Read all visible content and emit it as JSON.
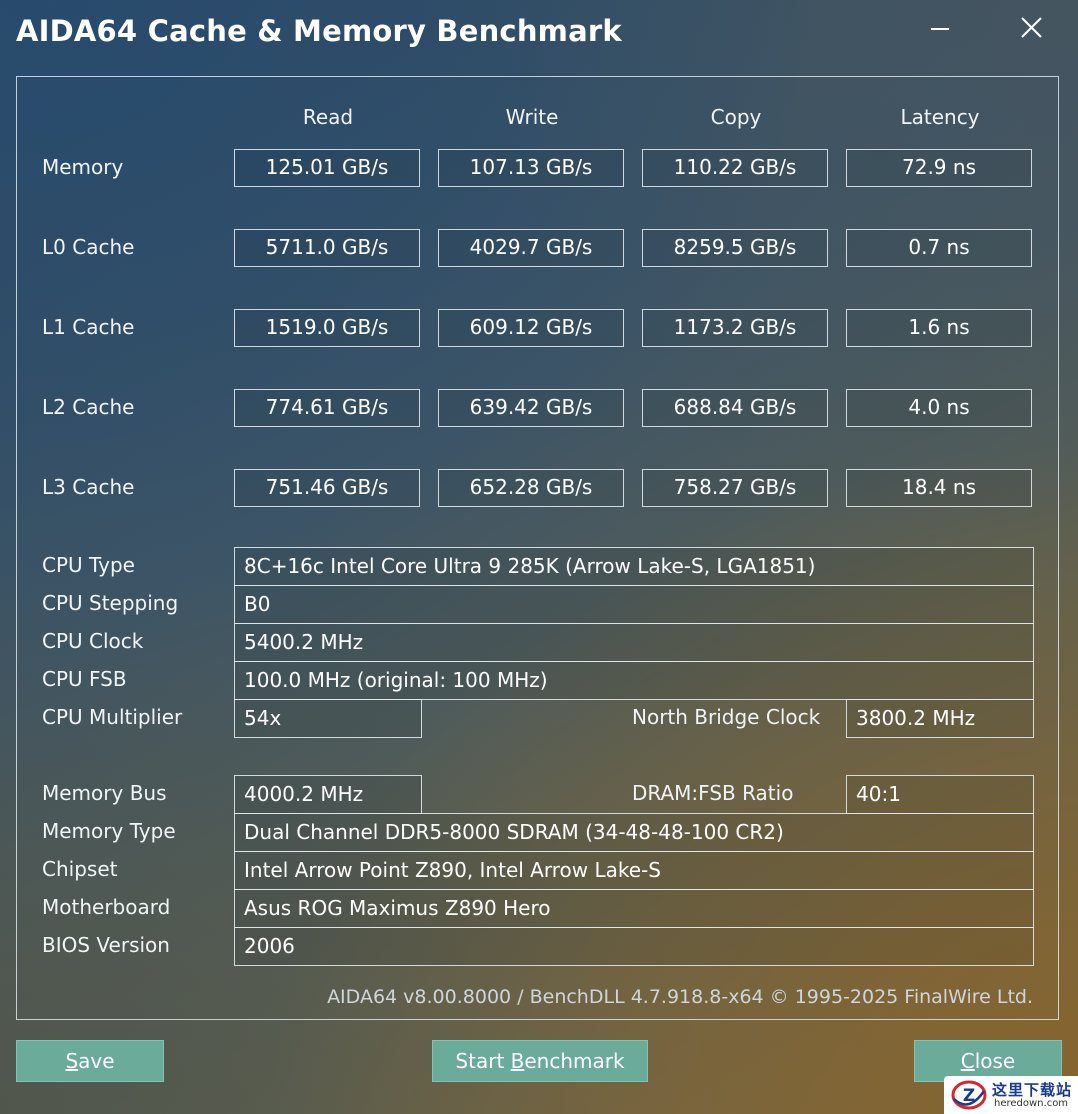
{
  "window": {
    "title": "AIDA64 Cache & Memory Benchmark"
  },
  "columns": [
    "Read",
    "Write",
    "Copy",
    "Latency"
  ],
  "benchmark_rows": [
    {
      "label": "Memory",
      "read": "125.01 GB/s",
      "write": "107.13 GB/s",
      "copy": "110.22 GB/s",
      "latency": "72.9 ns"
    },
    {
      "label": "L0 Cache",
      "read": "5711.0 GB/s",
      "write": "4029.7 GB/s",
      "copy": "8259.5 GB/s",
      "latency": "0.7 ns"
    },
    {
      "label": "L1 Cache",
      "read": "1519.0 GB/s",
      "write": "609.12 GB/s",
      "copy": "1173.2 GB/s",
      "latency": "1.6 ns"
    },
    {
      "label": "L2 Cache",
      "read": "774.61 GB/s",
      "write": "639.42 GB/s",
      "copy": "688.84 GB/s",
      "latency": "4.0 ns"
    },
    {
      "label": "L3 Cache",
      "read": "751.46 GB/s",
      "write": "652.28 GB/s",
      "copy": "758.27 GB/s",
      "latency": "18.4 ns"
    }
  ],
  "cpu_info": {
    "cpu_type": {
      "label": "CPU Type",
      "value": "8C+16c Intel Core Ultra 9 285K  (Arrow Lake-S, LGA1851)"
    },
    "cpu_stepping": {
      "label": "CPU Stepping",
      "value": "B0"
    },
    "cpu_clock": {
      "label": "CPU Clock",
      "value": "5400.2 MHz"
    },
    "cpu_fsb": {
      "label": "CPU FSB",
      "value": "100.0 MHz  (original: 100 MHz)"
    },
    "cpu_multiplier": {
      "label": "CPU Multiplier",
      "value": "54x"
    },
    "north_bridge_clock": {
      "label": "North Bridge Clock",
      "value": "3800.2 MHz"
    }
  },
  "memory_info": {
    "memory_bus": {
      "label": "Memory Bus",
      "value": "4000.2 MHz"
    },
    "dram_fsb_ratio": {
      "label": "DRAM:FSB Ratio",
      "value": "40:1"
    },
    "memory_type": {
      "label": "Memory Type",
      "value": "Dual Channel DDR5-8000 SDRAM  (34-48-48-100 CR2)"
    },
    "chipset": {
      "label": "Chipset",
      "value": "Intel Arrow Point Z890, Intel Arrow Lake-S"
    },
    "motherboard": {
      "label": "Motherboard",
      "value": "Asus ROG Maximus Z890 Hero"
    },
    "bios_version": {
      "label": "BIOS Version",
      "value": "2006"
    }
  },
  "footer": {
    "version_text": "AIDA64 v8.00.8000 / BenchDLL 4.7.918.8-x64 © 1995-2025 FinalWire Ltd."
  },
  "buttons": {
    "save": {
      "label": "Save",
      "accel_index": 0
    },
    "start": {
      "label": "Start Benchmark",
      "accel_index": 6
    },
    "close": {
      "label": "Close",
      "accel_index": 0
    }
  },
  "watermark": {
    "title": "这里下载站",
    "url": "heredown.com",
    "logo_letter": "Z"
  },
  "colors": {
    "button_bg": "#6aab99",
    "watermark_title": "#1a3c8c",
    "watermark_logo": "#d8262c"
  },
  "icons": {
    "minimize": "minimize-icon",
    "close": "close-icon"
  }
}
